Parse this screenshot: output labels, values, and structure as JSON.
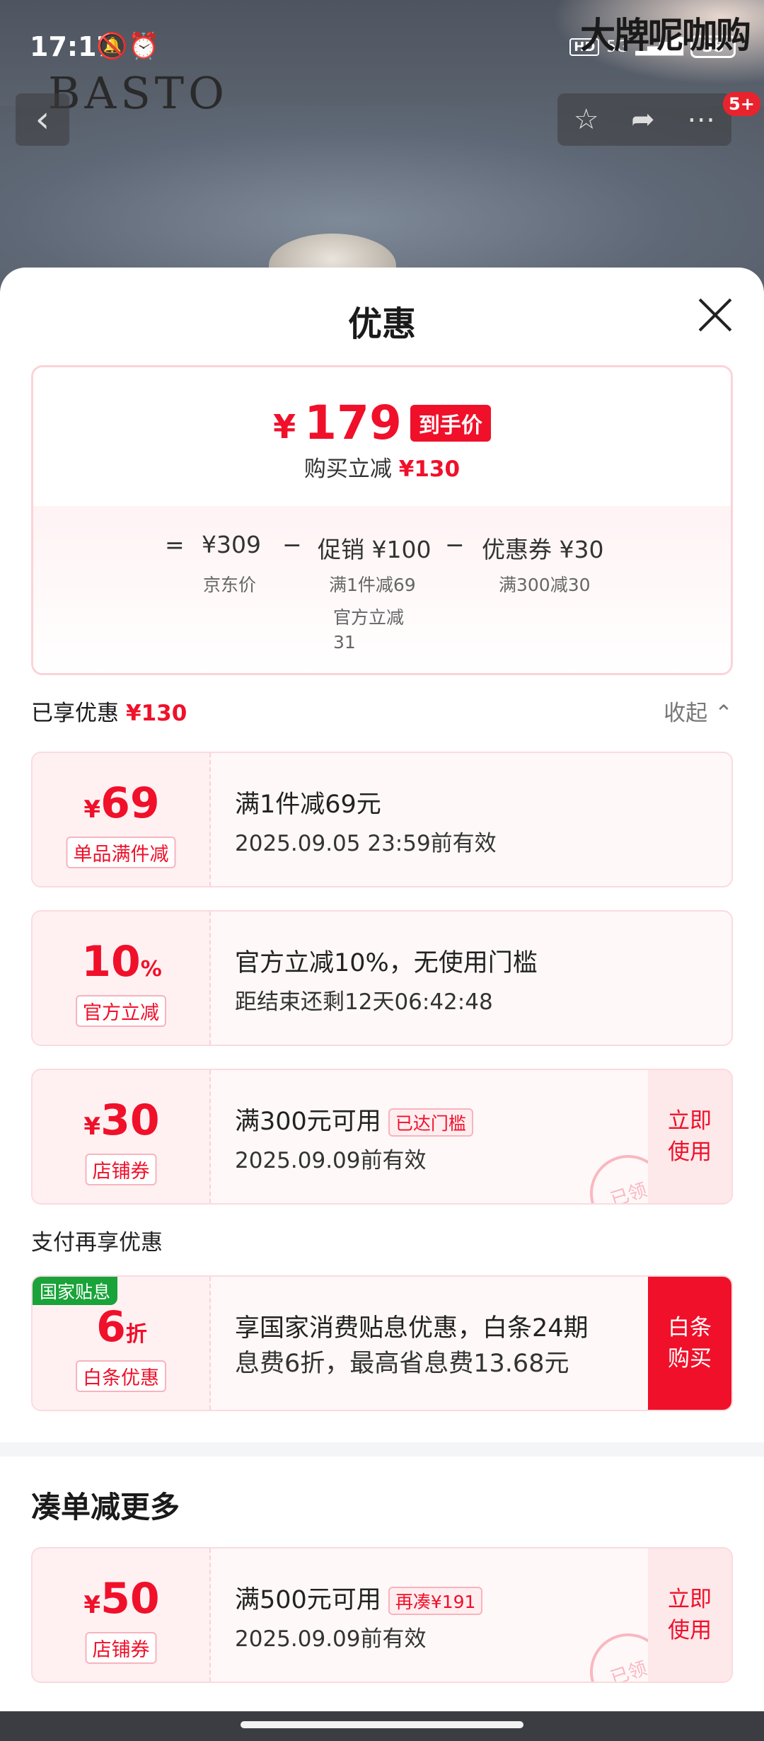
{
  "status": {
    "time": "17:17",
    "alarm_icons": "🔕⏰",
    "hd": "HD",
    "network": "5G",
    "battery": "38"
  },
  "watermark": "大牌呢咖购",
  "brand_logo": "BASTO",
  "nav": {
    "back_icon": "back-arrow",
    "badge": "5+"
  },
  "sheet": {
    "title": "优惠",
    "final_price": {
      "currency": "¥",
      "amount": "179",
      "tag": "到手价"
    },
    "instant_cut": {
      "label": "购买立减",
      "amount": "¥130"
    },
    "formula": {
      "equals": "=",
      "jd_price": "¥309",
      "minus1": "−",
      "promo": "促销 ¥100",
      "minus2": "−",
      "coupon": "优惠券 ¥30",
      "jd_price_label": "京东价",
      "promo_sub1": "满1件减69",
      "promo_sub2": "官方立减",
      "promo_sub3": "31",
      "coupon_sub": "满300减30"
    },
    "enjoyed": {
      "label": "已享优惠",
      "amount": "¥130",
      "collapse": "收起"
    },
    "coupons": [
      {
        "yen": "¥",
        "amount": "69",
        "label": "单品满件减",
        "main": "满1件减69元",
        "sub": "2025.09.05 23:59前有效"
      },
      {
        "amount": "10",
        "unit": "%",
        "label": "官方立减",
        "main": "官方立减10%，无使用门槛",
        "sub": "距结束还剩12天06:42:48"
      },
      {
        "yen": "¥",
        "amount": "30",
        "label": "店铺券",
        "main": "满300元可用",
        "tag": "已达门槛",
        "sub": "2025.09.09前有效",
        "button": "立即\n使用",
        "stamp": "已领"
      }
    ],
    "pay_title": "支付再享优惠",
    "pay_coupon": {
      "gov_tag": "国家贴息",
      "amount": "6",
      "unit": "折",
      "label": "白条优惠",
      "line1": "享国家消费贴息优惠，白条24期",
      "line2": "息费6折，最高省息费13.68元",
      "button": "白条\n购买"
    },
    "combine_title": "凑单减更多",
    "combine_coupon": {
      "yen": "¥",
      "amount": "50",
      "label": "店铺券",
      "main": "满500元可用",
      "tag": "再凑¥191",
      "sub": "2025.09.09前有效",
      "button": "立即\n使用",
      "stamp": "已领"
    }
  },
  "colors": {
    "accent": "#f0102a",
    "gov_green": "#19a339",
    "card_bg": "#fff1f2"
  }
}
